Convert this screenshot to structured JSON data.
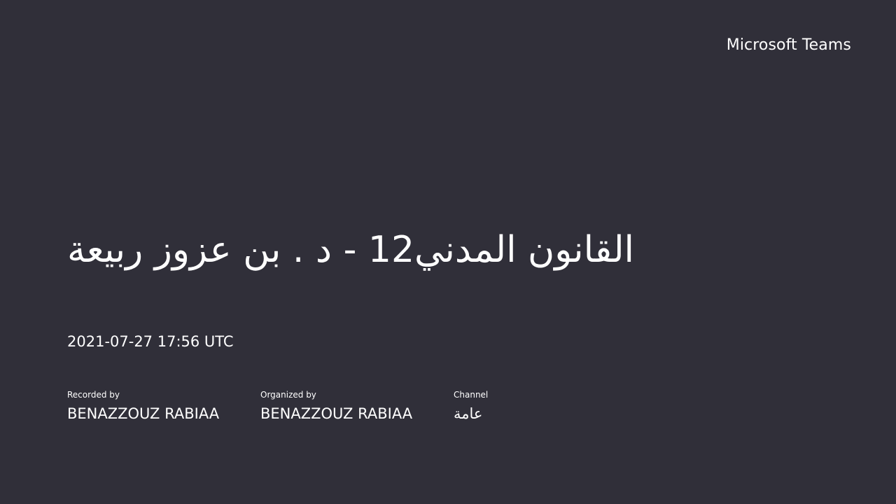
{
  "brand": "Microsoft Teams",
  "meeting": {
    "title": "القانون المدني12 - د . بن عزوز ربيعة",
    "timestamp": "2021-07-27 17:56 UTC"
  },
  "details": {
    "recorded_by": {
      "label": "Recorded by",
      "value": "BENAZZOUZ RABIAA"
    },
    "organized_by": {
      "label": "Organized by",
      "value": "BENAZZOUZ RABIAA"
    },
    "channel": {
      "label": "Channel",
      "value": "عامة"
    }
  },
  "colors": {
    "background": "#302f39",
    "text": "#ffffff"
  }
}
